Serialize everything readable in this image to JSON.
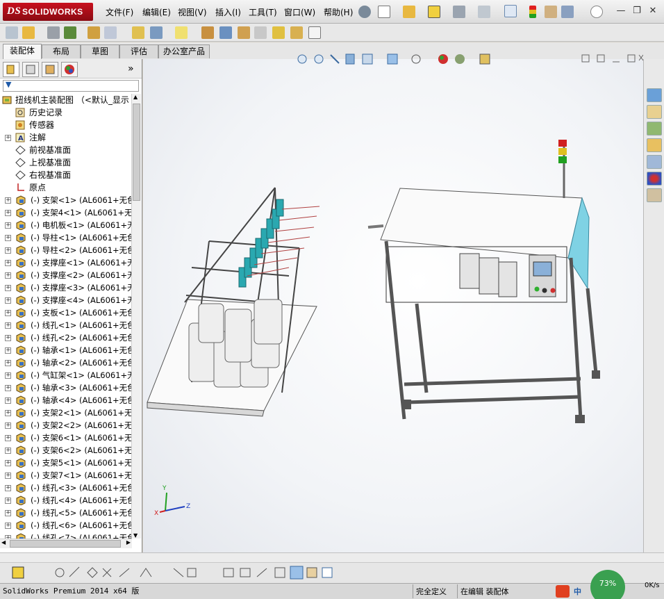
{
  "app": {
    "logo_text": "SOLIDWORKS",
    "logo_prefix": "DS"
  },
  "menu": [
    "文件(F)",
    "编辑(E)",
    "视图(V)",
    "插入(I)",
    "工具(T)",
    "窗口(W)",
    "帮助(H)"
  ],
  "command_tabs": [
    "装配体",
    "布局",
    "草图",
    "评估",
    "办公室产品"
  ],
  "active_tab": "装配体",
  "feature_manager": {
    "expand_label": "»",
    "root": "扭线机主装配图 （<默认_显示",
    "fixed_items": [
      "历史记录",
      "传感器",
      "注解",
      "前视基准面",
      "上视基准面",
      "右视基准面",
      "原点"
    ],
    "components": [
      "(-) 支架<1> (AL6061+无色",
      "(-) 支架4<1> (AL6061+无色",
      "(-) 电机板<1> (AL6061+无",
      "(-) 导柱<1> (AL6061+无色",
      "(-) 导柱<2> (AL6061+无色",
      "(-) 支撑座<1> (AL6061+无",
      "(-) 支撑座<2> (AL6061+无",
      "(-) 支撑座<3> (AL6061+无",
      "(-) 支撑座<4> (AL6061+无",
      "(-) 支板<1> (AL6061+无色",
      "(-) 线孔<1> (AL6061+无色",
      "(-) 线孔<2> (AL6061+无色",
      "(-) 轴承<1> (AL6061+无色",
      "(-) 轴承<2> (AL6061+无色",
      "(-) 气缸架<1> (AL6061+无",
      "(-) 轴承<3> (AL6061+无色",
      "(-) 轴承<4> (AL6061+无色",
      "(-) 支架2<1> (AL6061+无色",
      "(-) 支架2<2> (AL6061+无色",
      "(-) 支架6<1> (AL6061+无色",
      "(-) 支架6<2> (AL6061+无色",
      "(-) 支架5<1> (AL6061+无色",
      "(-) 支架7<1> (AL6061+无色",
      "(-) 线孔<3> (AL6061+无色",
      "(-) 线孔<4> (AL6061+无色",
      "(-) 线孔<5> (AL6061+无色",
      "(-) 线孔<6> (AL6061+无色",
      "(-) 线孔<7> (AL6061+无色"
    ]
  },
  "triad": {
    "x": "X",
    "y": "Y",
    "z": "Z"
  },
  "status": {
    "product": "SolidWorks Premium 2014 x64 版",
    "definition": "完全定义",
    "editing": "在编辑 装配体",
    "progress": "73%",
    "net": "0K/s",
    "ime": "中"
  },
  "colors": {
    "logo_red": "#b4141e",
    "accent_blue": "#1e5aa8"
  }
}
